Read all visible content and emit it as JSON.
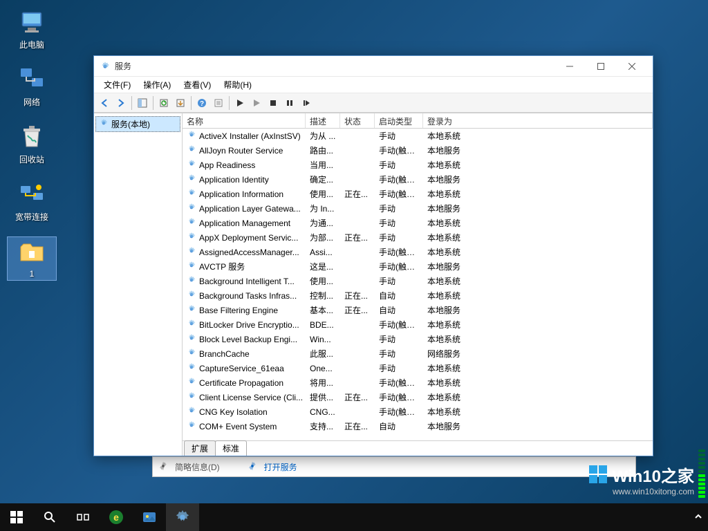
{
  "desktop": {
    "icons": [
      {
        "label": "此电脑",
        "name": "this-pc"
      },
      {
        "label": "网络",
        "name": "network"
      },
      {
        "label": "回收站",
        "name": "recycle-bin"
      },
      {
        "label": "宽带连接",
        "name": "broadband"
      },
      {
        "label": "1",
        "name": "folder-1",
        "selected": true
      }
    ]
  },
  "watermark": {
    "brand": "Win10之家",
    "url": "www.win10xitong.com"
  },
  "window": {
    "title": "服务",
    "menus": [
      "文件(F)",
      "操作(A)",
      "查看(V)",
      "帮助(H)"
    ],
    "tree_root": "服务(本地)",
    "columns": [
      "名称",
      "描述",
      "状态",
      "启动类型",
      "登录为"
    ],
    "tabs": [
      "扩展",
      "标准"
    ],
    "services": [
      {
        "name": "ActiveX Installer (AxInstSV)",
        "desc": "为从 ...",
        "status": "",
        "startup": "手动",
        "logon": "本地系统"
      },
      {
        "name": "AllJoyn Router Service",
        "desc": "路由...",
        "status": "",
        "startup": "手动(触发...",
        "logon": "本地服务"
      },
      {
        "name": "App Readiness",
        "desc": "当用...",
        "status": "",
        "startup": "手动",
        "logon": "本地系统"
      },
      {
        "name": "Application Identity",
        "desc": "确定...",
        "status": "",
        "startup": "手动(触发...",
        "logon": "本地服务"
      },
      {
        "name": "Application Information",
        "desc": "使用...",
        "status": "正在...",
        "startup": "手动(触发...",
        "logon": "本地系统"
      },
      {
        "name": "Application Layer Gatewa...",
        "desc": "为 In...",
        "status": "",
        "startup": "手动",
        "logon": "本地服务"
      },
      {
        "name": "Application Management",
        "desc": "为通...",
        "status": "",
        "startup": "手动",
        "logon": "本地系统"
      },
      {
        "name": "AppX Deployment Servic...",
        "desc": "为部...",
        "status": "正在...",
        "startup": "手动",
        "logon": "本地系统"
      },
      {
        "name": "AssignedAccessManager...",
        "desc": "Assi...",
        "status": "",
        "startup": "手动(触发...",
        "logon": "本地系统"
      },
      {
        "name": "AVCTP 服务",
        "desc": "这是...",
        "status": "",
        "startup": "手动(触发...",
        "logon": "本地服务"
      },
      {
        "name": "Background Intelligent T...",
        "desc": "使用...",
        "status": "",
        "startup": "手动",
        "logon": "本地系统"
      },
      {
        "name": "Background Tasks Infras...",
        "desc": "控制...",
        "status": "正在...",
        "startup": "自动",
        "logon": "本地系统"
      },
      {
        "name": "Base Filtering Engine",
        "desc": "基本...",
        "status": "正在...",
        "startup": "自动",
        "logon": "本地服务"
      },
      {
        "name": "BitLocker Drive Encryptio...",
        "desc": "BDE...",
        "status": "",
        "startup": "手动(触发...",
        "logon": "本地系统"
      },
      {
        "name": "Block Level Backup Engi...",
        "desc": "Win...",
        "status": "",
        "startup": "手动",
        "logon": "本地系统"
      },
      {
        "name": "BranchCache",
        "desc": "此服...",
        "status": "",
        "startup": "手动",
        "logon": "网络服务"
      },
      {
        "name": "CaptureService_61eaa",
        "desc": "One...",
        "status": "",
        "startup": "手动",
        "logon": "本地系统"
      },
      {
        "name": "Certificate Propagation",
        "desc": "将用...",
        "status": "",
        "startup": "手动(触发...",
        "logon": "本地系统"
      },
      {
        "name": "Client License Service (Cli...",
        "desc": "提供...",
        "status": "正在...",
        "startup": "手动(触发...",
        "logon": "本地系统"
      },
      {
        "name": "CNG Key Isolation",
        "desc": "CNG...",
        "status": "",
        "startup": "手动(触发...",
        "logon": "本地系统"
      },
      {
        "name": "COM+ Event System",
        "desc": "支持...",
        "status": "正在...",
        "startup": "自动",
        "logon": "本地服务"
      }
    ]
  },
  "under": {
    "label1": "简略信息(D)",
    "label2": "打开服务"
  }
}
